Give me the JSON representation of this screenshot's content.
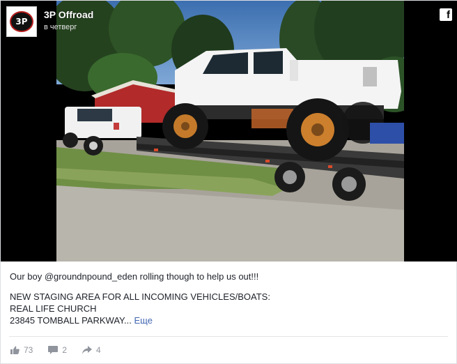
{
  "page": {
    "name": "3P Offroad",
    "time": "в четверг",
    "avatar_text": "3P"
  },
  "platform_icon": "f",
  "caption": {
    "line1": "Our boy @groundnpound_eden rolling though to help us out!!!",
    "line2": "NEW STAGING AREA FOR ALL INCOMING VEHICLES/BOATS:",
    "line3": "REAL LIFE CHURCH",
    "line4": "23845 TOMBALL PARKWAY...",
    "more": "Еще"
  },
  "stats": {
    "likes": "73",
    "comments": "2",
    "shares": "4"
  },
  "icons": {
    "like": "thumbs-up-icon",
    "comment": "comment-icon",
    "share": "share-icon",
    "platform": "facebook-icon"
  },
  "colors": {
    "link": "#4267b2",
    "stat_text": "#90949c",
    "caption_text": "#1d2129"
  }
}
